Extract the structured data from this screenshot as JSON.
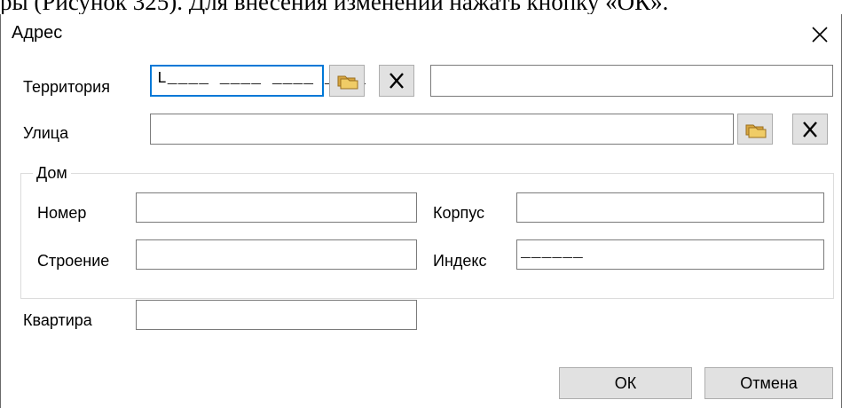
{
  "document_text": "ры (Рисунок 325). Для внесения изменений нажать кнопку «ОК».",
  "dialog": {
    "title": "Адрес",
    "close_icon": "close-icon"
  },
  "fields": {
    "territory_label": "Территория",
    "territory_mask": "L____ ____ ____ ____",
    "street_label": "Улица",
    "house_group_label": "Дом",
    "number_label": "Номер",
    "building_label": "Строение",
    "korpus_label": "Корпус",
    "index_label": "Индекс",
    "index_mask": "______",
    "apartment_label": "Квартира"
  },
  "buttons": {
    "ok": "ОК",
    "cancel": "Отмена",
    "select_icon": "folder-select-icon",
    "clear_icon": "clear-x-icon"
  },
  "colors": {
    "focus_border": "#0078d7",
    "button_bg": "#e1e1e1"
  }
}
